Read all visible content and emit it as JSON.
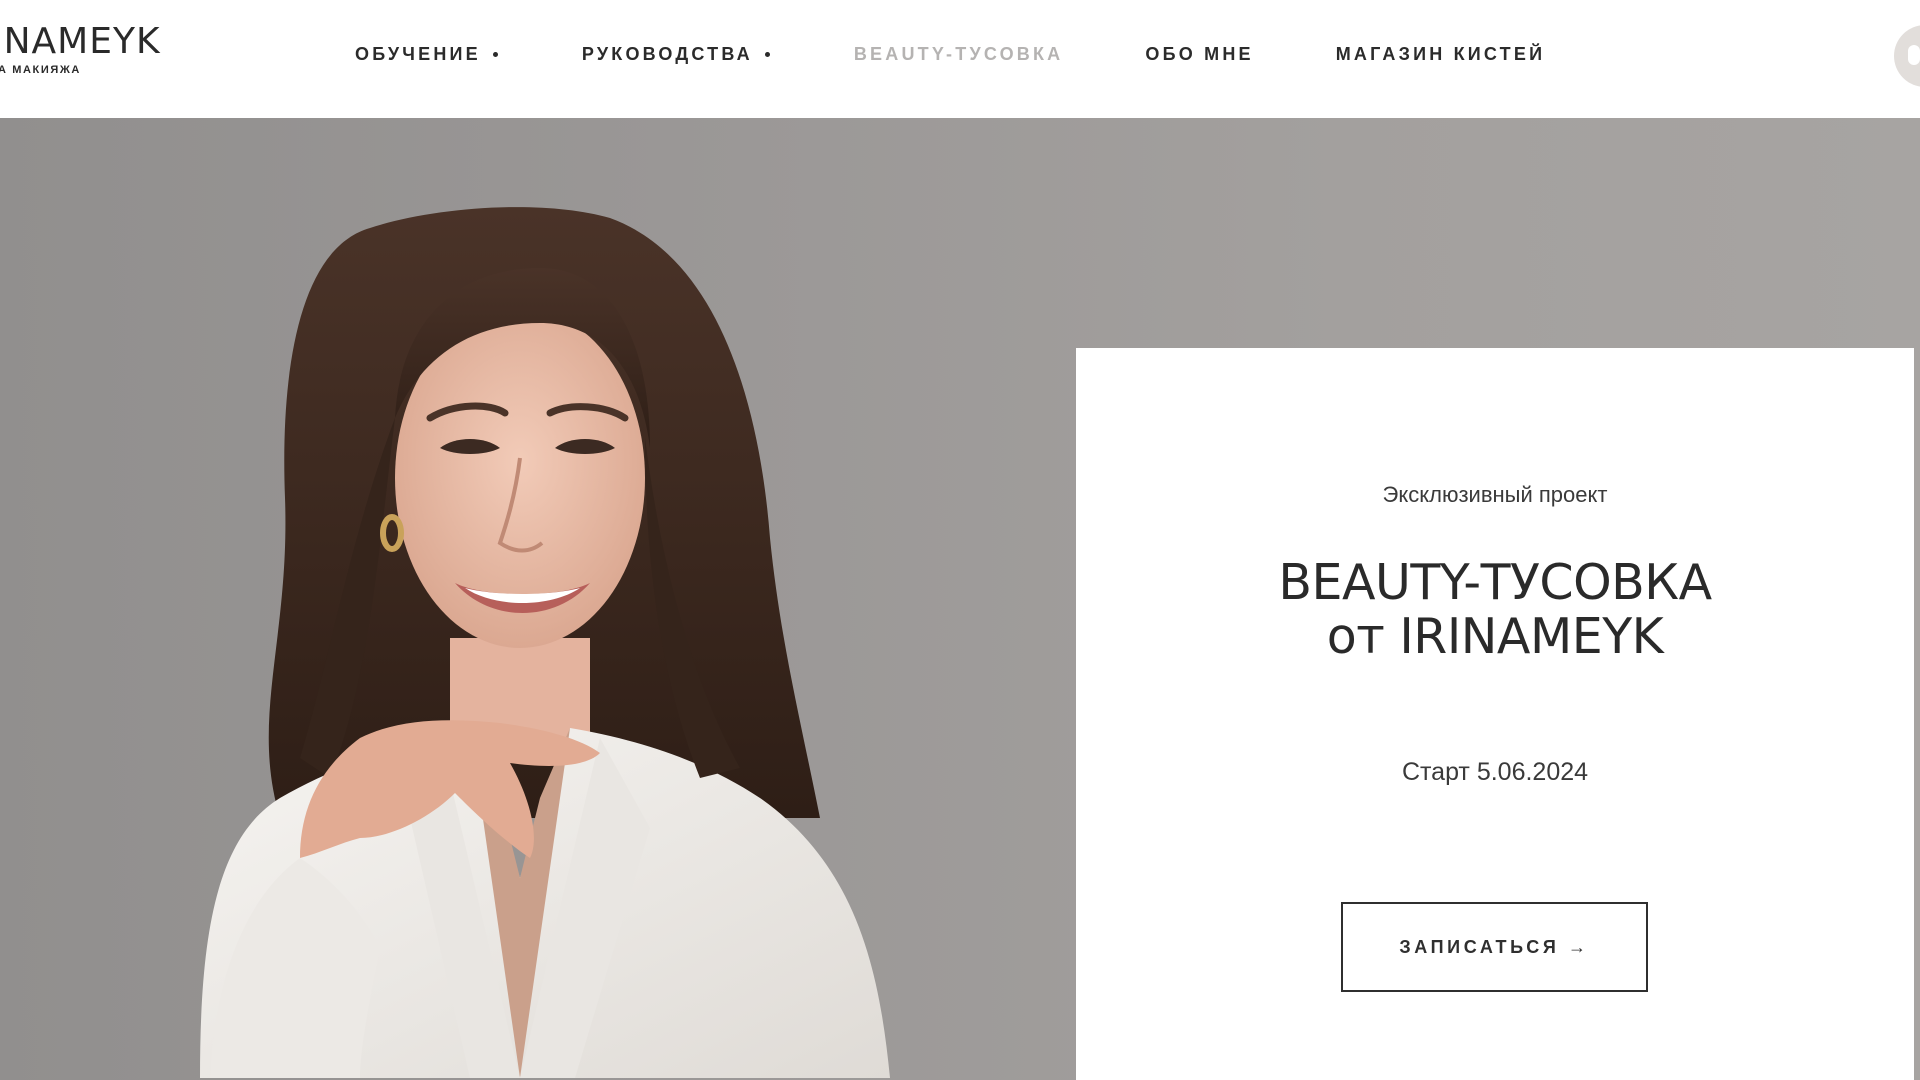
{
  "brand": {
    "logo_text": "INAMEYK",
    "logo_subtitle": "А МАКИЯЖА"
  },
  "nav": {
    "items": [
      {
        "label": "ОБУЧЕНИЕ",
        "has_dropdown": true,
        "active": false
      },
      {
        "label": "РУКОВОДСТВА",
        "has_dropdown": true,
        "active": false
      },
      {
        "label": "BEAUTY-ТУСОВКА",
        "has_dropdown": false,
        "active": true
      },
      {
        "label": "ОБО МНЕ",
        "has_dropdown": false,
        "active": false
      },
      {
        "label": "МАГАЗИН КИСТЕЙ",
        "has_dropdown": false,
        "active": false
      }
    ]
  },
  "hero": {
    "photo_icon": "portrait-photo",
    "card": {
      "eyebrow": "Эксклюзивный проект",
      "title_line1": "BEAUTY-ТУСОВКА",
      "title_line2": "от IRINAMEYK",
      "date": "Старт 5.06.2024",
      "cta_label": "ЗАПИСАТЬСЯ →"
    }
  },
  "colors": {
    "background_gray": "#9a9796",
    "card_bg": "#ffffff",
    "text_dark": "#2a2a2a",
    "nav_active": "#b5b3b2"
  }
}
